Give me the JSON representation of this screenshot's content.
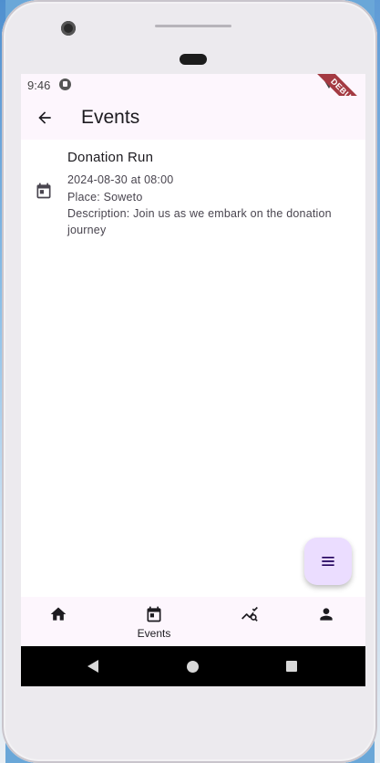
{
  "status_bar": {
    "time": "9:46",
    "debug_banner": "DEBUG"
  },
  "app_bar": {
    "title": "Events",
    "back_icon": "arrow-back-icon"
  },
  "events": [
    {
      "title": "Donation Run",
      "date": "2024-08-30 at 08:00",
      "place": "Place: Soweto",
      "description": "Description: Join us as we embark on the donation journey",
      "icon": "calendar-icon"
    }
  ],
  "fab": {
    "icon": "menu-icon",
    "color": "#ebddff"
  },
  "bottom_nav": {
    "items": [
      {
        "icon": "home-icon",
        "label": ""
      },
      {
        "icon": "calendar-icon",
        "label": "Events"
      },
      {
        "icon": "chart-search-icon",
        "label": ""
      },
      {
        "icon": "person-icon",
        "label": ""
      }
    ],
    "background": "#fdf6fd"
  },
  "colors": {
    "app_bar_bg": "#fdf6fd",
    "debug_banner": "#a43a42",
    "text_primary": "#1d1b20",
    "text_secondary": "#49454f"
  }
}
